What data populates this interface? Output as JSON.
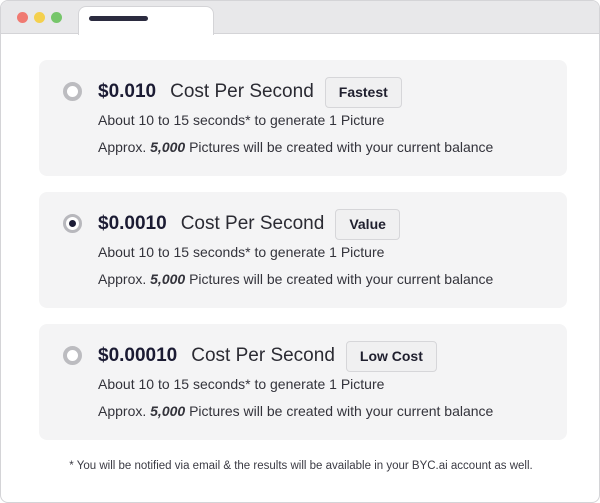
{
  "options": [
    {
      "price": "$0.010",
      "unit_label": "Cost Per Second",
      "badge": "Fastest",
      "selected": false,
      "time_text": "About 10 to 15 seconds* to generate 1 Picture",
      "approx_prefix": "Approx.",
      "approx_count": "5,000",
      "approx_suffix": "Pictures will be created with your current balance"
    },
    {
      "price": "$0.0010",
      "unit_label": "Cost Per Second",
      "badge": "Value",
      "selected": true,
      "time_text": "About 10 to 15 seconds* to generate 1 Picture",
      "approx_prefix": "Approx.",
      "approx_count": "5,000",
      "approx_suffix": "Pictures will be created with your current balance"
    },
    {
      "price": "$0.00010",
      "unit_label": "Cost Per Second",
      "badge": "Low Cost",
      "selected": false,
      "time_text": "About 10 to 15 seconds* to generate 1 Picture",
      "approx_prefix": "Approx.",
      "approx_count": "5,000",
      "approx_suffix": "Pictures will be created with your current balance"
    }
  ],
  "footnote": "* You will be notified via email & the results will be available in your BYC.ai account as well.",
  "colors": {
    "card_bg": "#f4f4f5",
    "price_text": "#1b1b33",
    "radio_selected_dot": "#1c1c36"
  }
}
